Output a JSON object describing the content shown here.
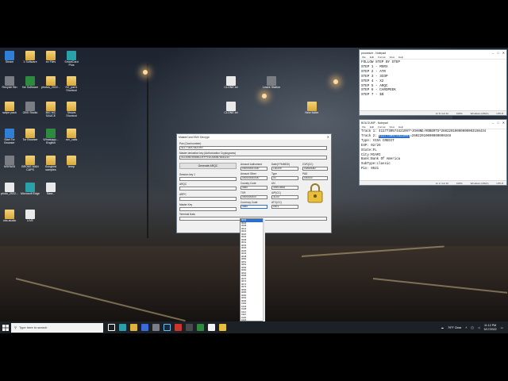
{
  "desktop_icons": [
    {
      "label": "Steam",
      "icon": "steam-icon",
      "color": "#1b2838"
    },
    {
      "label": "1 Software",
      "icon": "folder-icon"
    },
    {
      "label": "ex Files",
      "icon": "folder-icon"
    },
    {
      "label": "SmartCard Plus",
      "icon": "smartcard-icon"
    },
    {
      "label": "Recycle Bin",
      "icon": "recycle-bin-icon"
    },
    {
      "label": "fire Software",
      "icon": "app-icon"
    },
    {
      "label": "photos_2022...",
      "icon": "folder-icon"
    },
    {
      "label": "HZ_part1 Shortcut",
      "icon": "folder-icon"
    },
    {
      "label": "swipe pack",
      "icon": "folder-icon"
    },
    {
      "label": "OBS Studio",
      "icon": "obs-icon"
    },
    {
      "label": "BIG MC SAUCE",
      "icon": "folder-icon"
    },
    {
      "label": "Shows Shortcut",
      "icon": "folder-icon"
    },
    {
      "label": "Start Tor Browser",
      "icon": "tor-icon"
    },
    {
      "label": "Tor Browser",
      "icon": "folder-icon"
    },
    {
      "label": "Whatsapp... English",
      "icon": "app-icon"
    },
    {
      "label": "cvv_calls",
      "icon": "folder-icon"
    },
    {
      "label": "MSR605",
      "icon": "app-icon"
    },
    {
      "label": "BROKE MAN CAPS",
      "icon": "folder-icon"
    },
    {
      "label": "Songbird samples",
      "icon": "folder-icon"
    },
    {
      "label": "temp",
      "icon": "folder-icon"
    },
    {
      "label": "photo_2022...",
      "icon": "doc-icon"
    },
    {
      "label": "Microsoft Edge",
      "icon": "edge-icon"
    },
    {
      "label": "Sara...",
      "icon": "doc-icon"
    },
    {
      "label": "obs-studio",
      "icon": "folder-icon"
    },
    {
      "label": "LIVE",
      "icon": "doc-icon"
    },
    {
      "label": "CLONE.txt",
      "icon": "doc-icon"
    },
    {
      "label": "Leave Station",
      "icon": "app-icon"
    },
    {
      "label": "CLONE.txt",
      "icon": "doc-icon"
    },
    {
      "label": "New folder",
      "icon": "folder-icon"
    }
  ],
  "notepad_steps": {
    "title": "procedure - Notepad",
    "menu": [
      "File",
      "Edit",
      "Format",
      "View",
      "Help"
    ],
    "lines": [
      "FOLLOW STEP BY STEP",
      "STEP 1 - MSRX",
      "STEP 2 - ATR",
      "STEP 3 - 3COP",
      "STEP 4 - X2",
      "STEP 5 - ARQC",
      "STEP 6 - CARDPEEK",
      "STEP 7 - $$"
    ],
    "status": [
      "Ln 8, Col 12",
      "100%",
      "Windows (CRLF)",
      "UTF-8"
    ]
  },
  "notepad_card": {
    "title": "BOA DUMP - Notepad",
    "menu": [
      "File",
      "Edit",
      "Format",
      "View",
      "Help"
    ],
    "track1": "Track 1: 4117730574421997^JOANNE/ROBERTS^26022010000000003198434",
    "track2_prefix": "Track 2: ",
    "track2_selected": "4117730574421997",
    "track2_rest": "=26022010000000000348",
    "lines": [
      "Type: VISA CREDIT",
      "EXP: 02/26",
      "State:FL",
      "City:MIAMI",
      "Bank:Bank Of America",
      "SubType:classic",
      "Pin: 9521"
    ],
    "status": [
      "Ln 2, Col 10",
      "100%",
      "Windows (CRLF)",
      "UTF-8"
    ]
  },
  "mastercard": {
    "title": "MasterCard EMV Decrypt",
    "pan_label": "Pan (Card number)",
    "pan_value": "4117730574421997",
    "mk_label": "Master derivation key (Authorization Cryptograms)",
    "mk_value": "0123456789ABCDEFFEDCBA9876543210",
    "generate_label": "Generate ARQC",
    "session_label": "Session key 1",
    "arqc_label": "ARQC",
    "arpc_label": "ARPC",
    "master_key_label": "Master Key",
    "terminal_label": "Terminal Data",
    "amount_auth_label": "Amount Authorised",
    "amount_auth_value": "000000001000",
    "amount_other_label": "Amount Other",
    "amount_other_value": "000000000000",
    "country_label": "Country Code",
    "country_value": "0840",
    "tvr_label": "TVR",
    "tvr_value": "0000000000",
    "currency_label": "Currency Code",
    "currency_value": "0840",
    "date_label": "Date(YYMMDD)",
    "date_value": "130209",
    "type_label": "Type",
    "type_value": "00",
    "un_label": "UN",
    "un_value": "30901B6A",
    "aip_label": "AIP(CC)",
    "aip_value": "3C00",
    "atc_label": "ATC(CC)",
    "atc_value": "0001",
    "cvr_label": "CVR(CC)",
    "cvr_value": "03A4A082",
    "pad_label": "PAD",
    "pad_value": "000000",
    "dropdown_items": [
      "0840",
      "0004",
      "0008",
      "0012",
      "0016",
      "0020",
      "0024",
      "0028",
      "0031",
      "0032",
      "0036",
      "0040",
      "0044",
      "0048",
      "0050",
      "0051",
      "0052",
      "0056",
      "0060",
      "0064",
      "0068",
      "0070",
      "0072",
      "0074",
      "0076",
      "0084",
      "0086",
      "0090",
      "0092",
      "0096",
      "0100",
      "0104",
      "0108",
      "0112",
      "0116",
      "0120",
      "0124",
      "0132",
      "0136"
    ]
  },
  "taskbar": {
    "search_placeholder": "Type here to search",
    "weather": "79°F Clear",
    "time": "11:12 PM",
    "date": "5/17/2022"
  }
}
